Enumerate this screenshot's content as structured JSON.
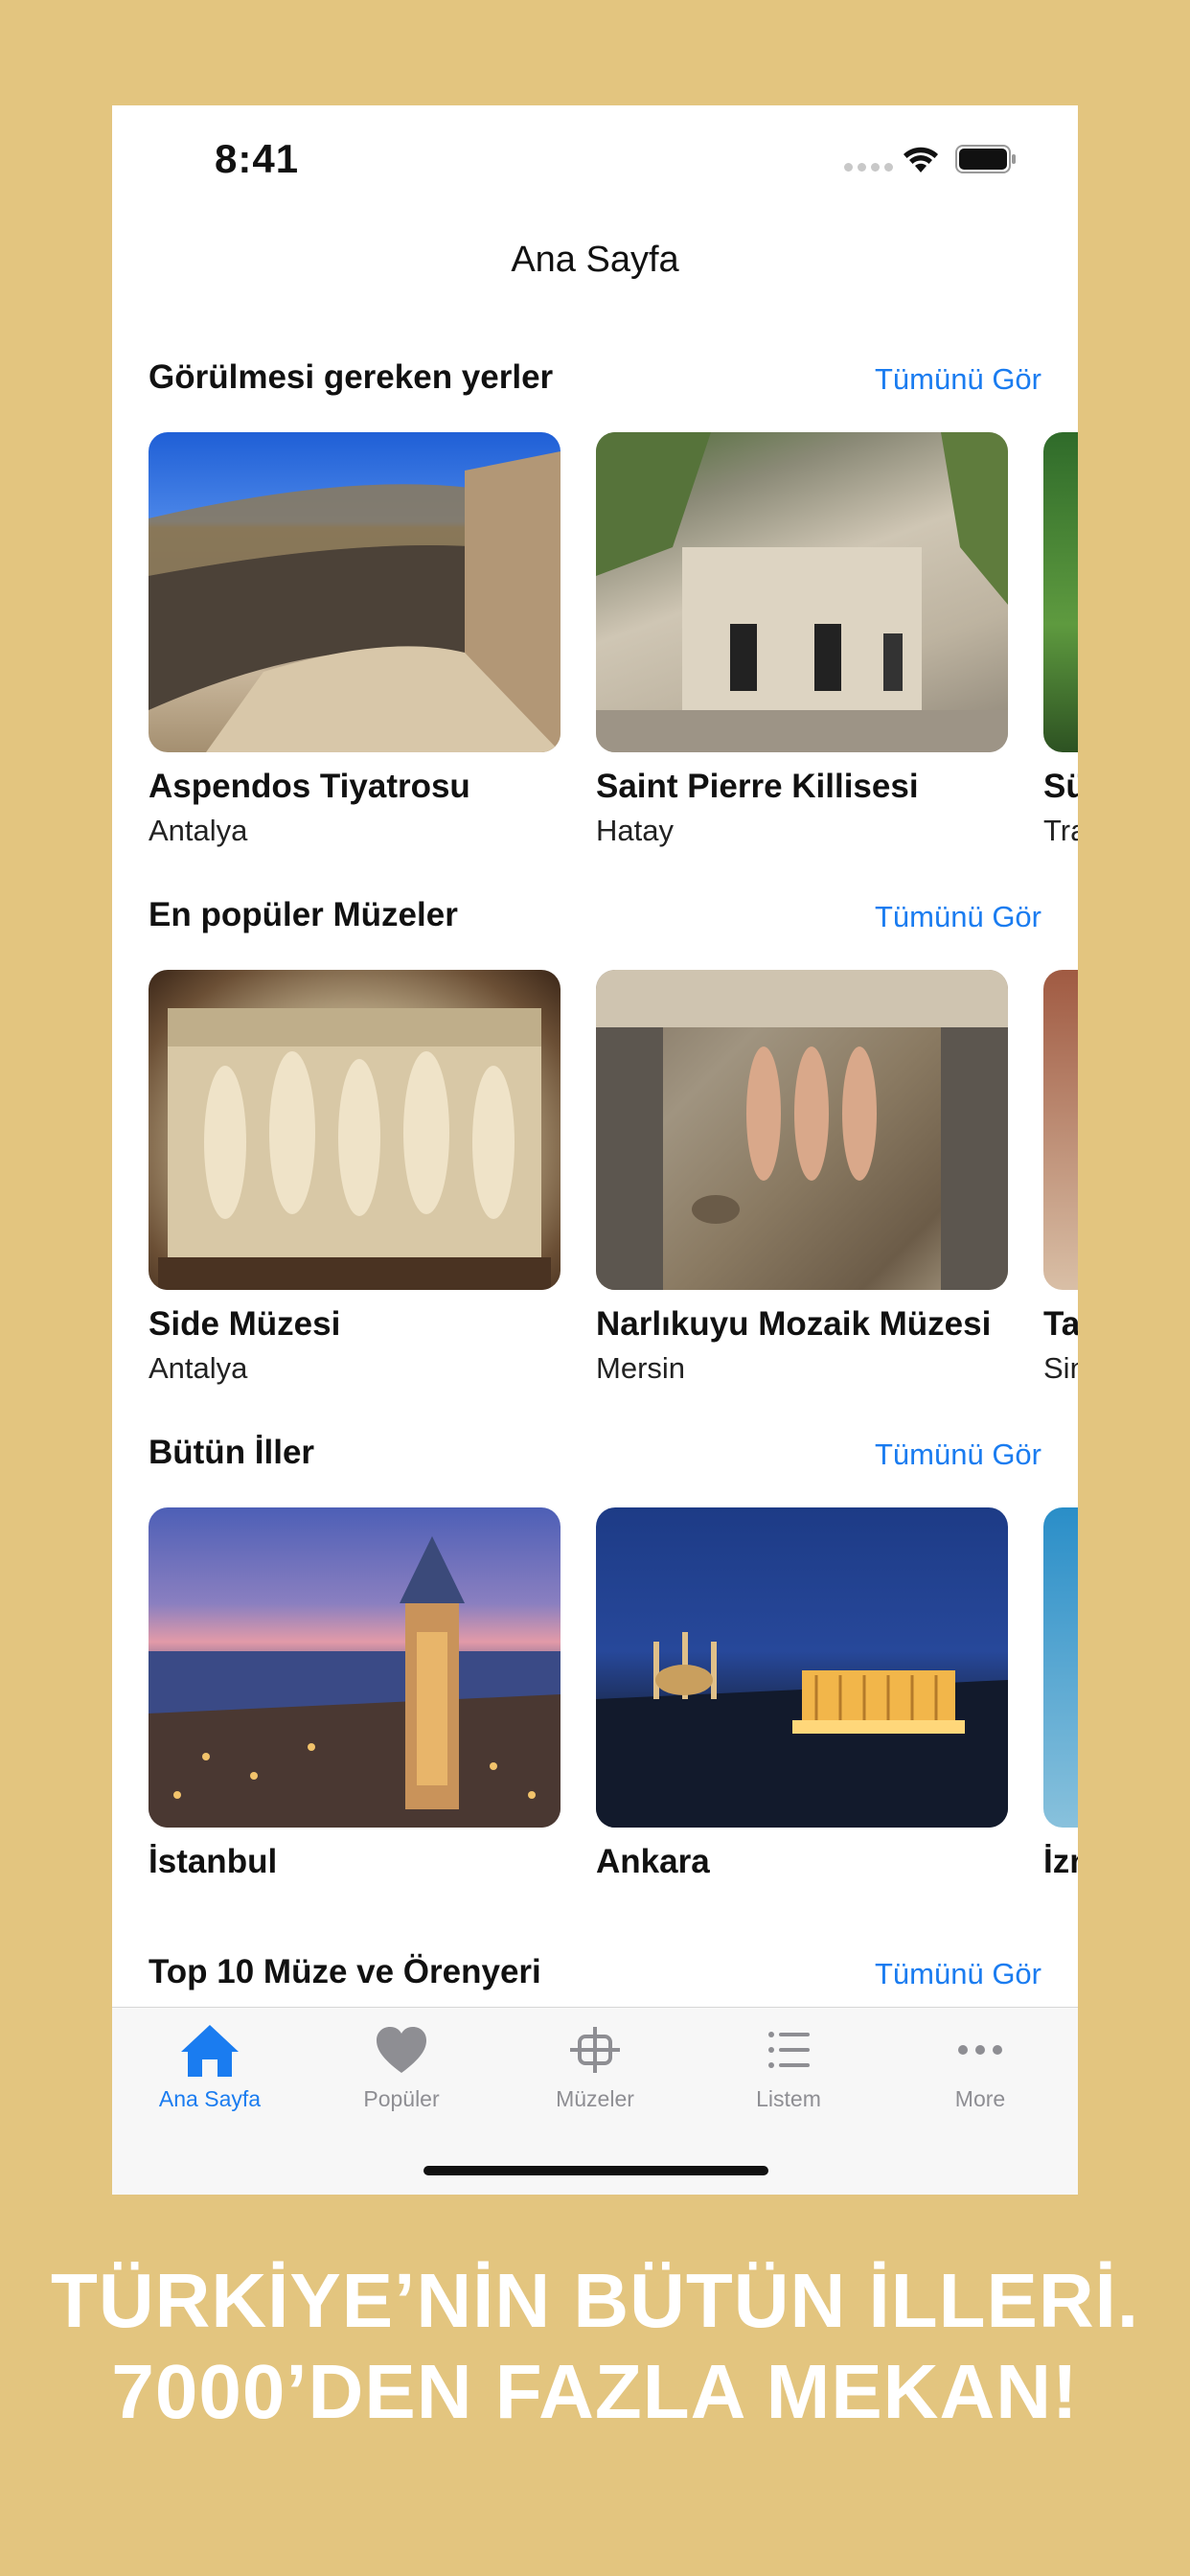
{
  "status_bar": {
    "time": "8:41"
  },
  "nav": {
    "title": "Ana Sayfa"
  },
  "sections": [
    {
      "title": "Görülmesi gereken yerler",
      "see_all": "Tümünü Gör",
      "cards": [
        {
          "title": "Aspendos Tiyatrosu",
          "subtitle": "Antalya"
        },
        {
          "title": "Saint Pierre Killisesi",
          "subtitle": "Hatay"
        },
        {
          "title": "Sü",
          "subtitle": "Tra"
        }
      ]
    },
    {
      "title": "En popüler Müzeler",
      "see_all": "Tümünü Gör",
      "cards": [
        {
          "title": "Side Müzesi",
          "subtitle": "Antalya"
        },
        {
          "title": "Narlıkuyu Mozaik Müzesi",
          "subtitle": "Mersin"
        },
        {
          "title": "Ta",
          "subtitle": "Sin"
        }
      ]
    },
    {
      "title": "Bütün İller",
      "see_all": "Tümünü Gör",
      "cards": [
        {
          "title": "İstanbul"
        },
        {
          "title": "Ankara"
        },
        {
          "title": "İzn"
        }
      ]
    },
    {
      "title": "Top 10 Müze ve Örenyeri",
      "see_all": "Tümünü Gör"
    }
  ],
  "tab_bar": {
    "items": [
      {
        "label": "Ana Sayfa",
        "icon": "home-icon",
        "active": true
      },
      {
        "label": "Popüler",
        "icon": "heart-icon"
      },
      {
        "label": "Müzeler",
        "icon": "museum-icon"
      },
      {
        "label": "Listem",
        "icon": "list-icon"
      },
      {
        "label": "More",
        "icon": "more-icon"
      }
    ]
  },
  "colors": {
    "accent": "#1a7cf0",
    "background": "#e3c57f",
    "inactive": "#8e8e93"
  },
  "promo": {
    "line1": "TÜRKİYE’NİN BÜTÜN İLLERİ.",
    "line2": "7000’DEN FAZLA MEKAN!"
  }
}
